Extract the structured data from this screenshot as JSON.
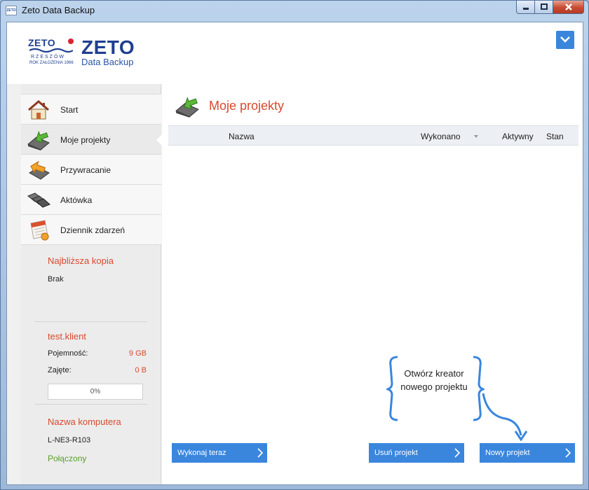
{
  "window": {
    "title": "Zeto Data Backup",
    "icon_text": "ZETO",
    "controls": {
      "minimize_icon": "minimize-icon",
      "maximize_icon": "maximize-icon",
      "close_icon": "close-icon"
    }
  },
  "brand": {
    "logo_text": "ZETO",
    "logo_city": "RZESZÓW",
    "logo_year": "ROK ZAŁOŻENIA 1966",
    "name": "ZETO",
    "subtitle": "Data Backup"
  },
  "sidebar": {
    "items": [
      {
        "label": "Start",
        "icon": "home-icon"
      },
      {
        "label": "Moje projekty",
        "icon": "projects-icon",
        "active": true
      },
      {
        "label": "Przywracanie",
        "icon": "restore-icon"
      },
      {
        "label": "Aktówka",
        "icon": "briefcase-icon"
      },
      {
        "label": "Dziennik zdarzeń",
        "icon": "calendar-log-icon"
      }
    ],
    "next_backup": {
      "title": "Najbliższa kopia",
      "value": "Brak"
    },
    "account": {
      "title": "test.klient",
      "capacity_label": "Pojemność:",
      "capacity_value": "9 GB",
      "used_label": "Zajęte:",
      "used_value": "0 B",
      "usage_percent": 0,
      "usage_text": "0%"
    },
    "computer": {
      "title": "Nazwa komputera",
      "name": "L-NE3-R103",
      "status": "Połączony"
    }
  },
  "main": {
    "title": "Moje projekty",
    "table": {
      "columns": [
        "Nazwa",
        "Wykonano",
        "Aktywny",
        "Stan"
      ],
      "rows": []
    },
    "callout": "Otwórz kreator nowego projektu",
    "buttons": {
      "run_now": "Wykonaj teraz",
      "delete_project": "Usuń projekt",
      "new_project": "Nowy projekt"
    }
  },
  "colors": {
    "accent": "#3a86dd",
    "title_red": "#d9492e",
    "connected_green": "#5aa02c",
    "brand_blue": "#1f3f91"
  }
}
